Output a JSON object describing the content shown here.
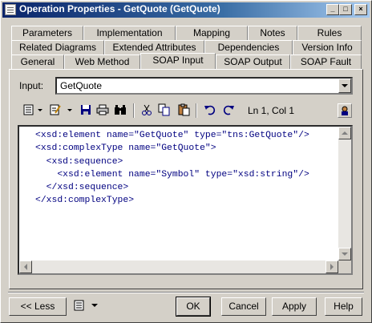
{
  "window": {
    "title": "Operation Properties - GetQuote (GetQuote)",
    "controls": {
      "minimize": "_",
      "maximize": "□",
      "close": "×"
    }
  },
  "tabs": {
    "row1": [
      "Parameters",
      "Implementation",
      "Mapping",
      "Notes",
      "Rules"
    ],
    "row2": [
      "Related Diagrams",
      "Extended Attributes",
      "Dependencies",
      "Version Info"
    ],
    "row3": [
      "General",
      "Web Method",
      "SOAP Input",
      "SOAP Output",
      "SOAP Fault"
    ],
    "active": "SOAP Input"
  },
  "input": {
    "label": "Input:",
    "value": "GetQuote"
  },
  "toolbar": {
    "icons": [
      "properties-menu-icon",
      "edit-menu-icon",
      "save-icon",
      "print-icon",
      "find-icon",
      "cut-icon",
      "copy-icon",
      "paste-icon",
      "undo-icon",
      "redo-icon",
      "user-icon"
    ],
    "position": "Ln 1, Col 1"
  },
  "editor": {
    "lines": [
      "<xsd:element name=\"GetQuote\" type=\"tns:GetQuote\"/>",
      "<xsd:complexType name=\"GetQuote\">",
      "  <xsd:sequence>",
      "    <xsd:element name=\"Symbol\" type=\"xsd:string\"/>",
      "  </xsd:sequence>",
      "</xsd:complexType>"
    ]
  },
  "buttons": {
    "less": "<< Less",
    "ok": "OK",
    "cancel": "Cancel",
    "apply": "Apply",
    "help": "Help"
  }
}
